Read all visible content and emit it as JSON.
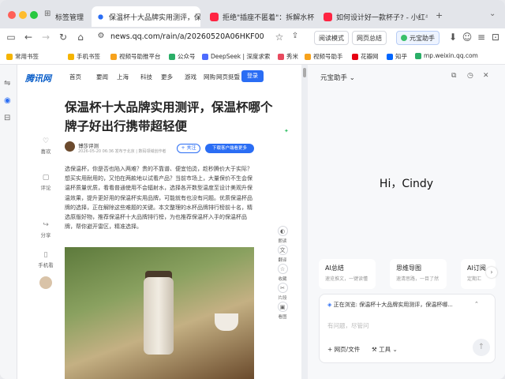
{
  "tabs": [
    {
      "label": "标签管理",
      "active": false
    },
    {
      "label": "保温杯十大品牌实用测评，保",
      "active": true
    },
    {
      "label": "拒绝\"插座不匿着\"：拆解水杯设计与",
      "active": false
    },
    {
      "label": "如何设计好一款杯子? - 小红书",
      "active": false
    }
  ],
  "toolbar": {
    "url": "news.qq.com/rain/a/20260520A06HKF00",
    "reading_mode": "阅读模式",
    "page_summary": "网页总结",
    "assistant_btn": "元宝助手"
  },
  "bookmarks": [
    "常用书签",
    "手机书签",
    "视频号助推平台",
    "公众号",
    "DeepSeek | 深度求索",
    "秀米",
    "视频号助手",
    "花瓣网",
    "知乎",
    "mp.weixin.qq.com"
  ],
  "site": {
    "logo": "腾讯网",
    "nav": [
      "首页",
      "要闻",
      "上海",
      "科技",
      "更多",
      "游戏",
      "网购",
      "网页挺暨"
    ],
    "login": "登录"
  },
  "article": {
    "title": "保温杯十大品牌实用测评，保温杯哪个牌子好出行携带超轻便",
    "author": "博莎评测",
    "meta": "2026-05-20 06:36 发布于北京 | 数码领域创作者",
    "follow": "+ 关注",
    "download": "下载客户端看更多",
    "body": "选保温杯，你是否也陷入两难？贵的不靠谱、便宜怕烫，趁秒腾价大于实际？想买实用耐用的，又怕在两款地以试看产品？当前市场上，大量保价不生会保温杯质量优质，看看普通使用不会辐射水，选择各开数型温度至设计美观升保温效果，提升更好用的保温杯实用品牌，可能就有也没有问题。优质保温杯品牌的选择，正在解除这些难题的关键。本文整理的水杯品牌排行榜前十名，精选原版好物，推荐保温杯十大品牌排行榜，为也推荐保温杯入手的保温杯品牌，帮你避开雷区，精准选择。",
    "side_actions": [
      "喜欢",
      "评论",
      "分享",
      "手机看"
    ],
    "floating": [
      "朗读",
      "翻译",
      "收藏",
      "片段",
      "看图"
    ]
  },
  "assistant": {
    "title": "元宝助手",
    "greeting": "Hi，Cindy",
    "cards": [
      {
        "title": "AI总结",
        "sub": "速览推文，一键读懂"
      },
      {
        "title": "思维导图",
        "sub": "速清思路，一目了然"
      },
      {
        "title": "AI订阅",
        "sub": "定期汇"
      }
    ],
    "context": "正在浏览: 保温杯十大品牌实用测评，保温杯哪...",
    "placeholder": "有问题，尽管问",
    "attach": "+ 网页/文件",
    "tools": "工具"
  }
}
